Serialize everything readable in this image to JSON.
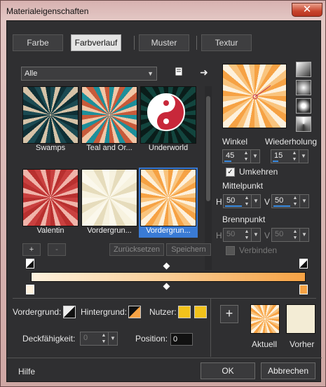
{
  "window": {
    "title": "Materialeigenschaften",
    "close_label": "✕"
  },
  "tabs": [
    "Farbe",
    "Farbverlauf",
    "Muster",
    "Textur"
  ],
  "active_tab": "Farbverlauf",
  "category": {
    "value": "Alle"
  },
  "gallery": [
    {
      "label": "Swamps"
    },
    {
      "label": "Teal and Or..."
    },
    {
      "label": "Underworld"
    },
    {
      "label": "Valentin"
    },
    {
      "label": "Vordergrun..."
    },
    {
      "label": "Vordergrun..."
    }
  ],
  "buttons": {
    "add": "+",
    "remove": "-",
    "reset": "Zurücksetzen",
    "save": "Speichern",
    "add_big": "+",
    "ok": "OK",
    "cancel": "Abbrechen",
    "help": "Hilfe"
  },
  "angle": {
    "label": "Winkel",
    "value": "45"
  },
  "repeat": {
    "label": "Wiederholung",
    "value": "15"
  },
  "invert": {
    "label": "Umkehren",
    "checked": true
  },
  "center": {
    "label": "Mittelpunkt",
    "h_label": "H",
    "h_value": "50",
    "v_label": "V",
    "v_value": "50"
  },
  "focus": {
    "label": "Brennpunkt",
    "h_label": "H",
    "h_value": "50",
    "v_label": "V",
    "v_value": "50"
  },
  "link": {
    "label": "Verbinden",
    "checked": false
  },
  "bottom": {
    "foreground_label": "Vordergrund:",
    "background_label": "Hintergrund:",
    "user_label": "Nutzer:",
    "opacity_label": "Deckfähigkeit:",
    "opacity_value": "0",
    "position_label": "Position:",
    "position_value": "0",
    "current_label": "Aktuell",
    "previous_label": "Vorher"
  },
  "colors": {
    "user1": "#f2c21b",
    "user2": "#f2c21b",
    "accent": "#3a7bd5",
    "gradient_start": "#fdf1dd",
    "gradient_end": "#f6a244",
    "previous": "#f3ecd5"
  }
}
